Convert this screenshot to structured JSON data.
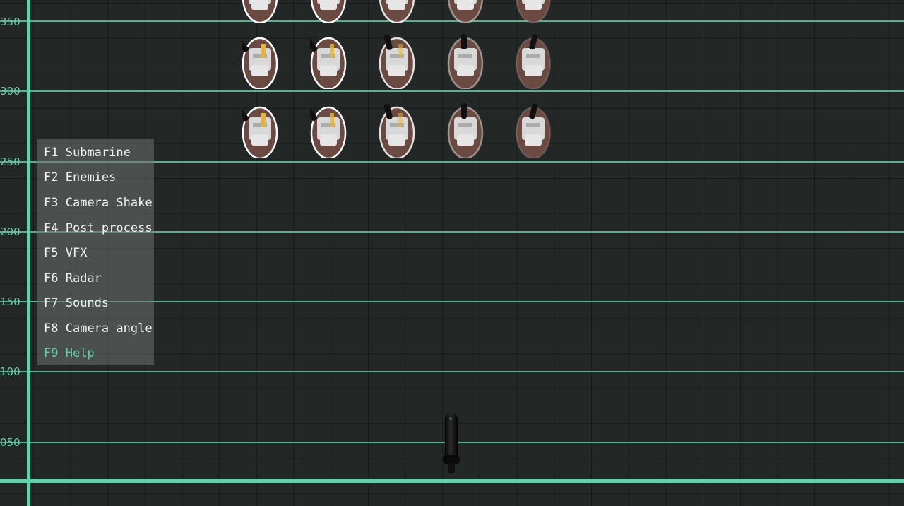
{
  "axis": {
    "ticks": [
      "350",
      "300",
      "250",
      "200",
      "150",
      "100",
      "050"
    ]
  },
  "menu": {
    "items": [
      {
        "key": "F1",
        "label": "Submarine"
      },
      {
        "key": "F2",
        "label": "Enemies"
      },
      {
        "key": "F3",
        "label": "Camera Shake"
      },
      {
        "key": "F4",
        "label": "Post process"
      },
      {
        "key": "F5",
        "label": "VFX"
      },
      {
        "key": "F6",
        "label": "Radar"
      },
      {
        "key": "F7",
        "label": "Sounds"
      },
      {
        "key": "F8",
        "label": "Camera angle"
      },
      {
        "key": "F9",
        "label": "Help"
      }
    ],
    "active_index": 8
  },
  "colors": {
    "background": "#232826",
    "gridline_accent": "#5fc9a6",
    "menu_text": "#f2f2f2",
    "menu_active": "#5fcfa9",
    "enemy_hull": "#6b4a42",
    "enemy_outline": "#ffffff",
    "enemy_accent": "#e8b531",
    "submarine": "#0c0c0c"
  },
  "icons": {
    "enemy": "enemy-ship-icon",
    "player": "submarine-icon"
  }
}
